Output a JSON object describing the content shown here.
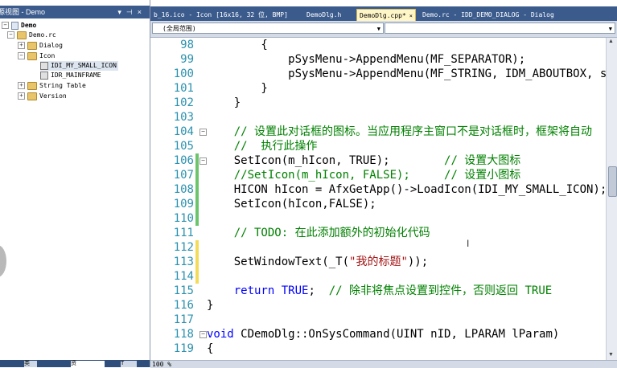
{
  "resource_view": {
    "title": "源视图 - Demo",
    "tree": [
      {
        "label": "Demo"
      },
      {
        "label": "Demo.rc"
      },
      {
        "label": "Dialog"
      },
      {
        "label": "Icon"
      },
      {
        "label": "IDI_MY_SMALL_ICON"
      },
      {
        "label": "IDR_MAINFRAME"
      },
      {
        "label": "String Table"
      },
      {
        "label": "Version"
      }
    ],
    "bottom_tabs": [
      {
        "label": "类"
      },
      {
        "label": "资"
      },
      {
        "label": "T"
      }
    ]
  },
  "tabs": [
    {
      "label": "b_16.ico - Icon [16x16, 32 位, BMP]"
    },
    {
      "label": "DemoDlg.h"
    },
    {
      "label": "DemoDlg.cpp*"
    },
    {
      "label": "Demo.rc - IDD_DEMO_DIALOG - Dialog"
    }
  ],
  "nav": {
    "scope_combo": "(全局范围)",
    "member_combo": ""
  },
  "status": {
    "zoom": "100 %"
  },
  "code": [
    {
      "num": "98",
      "text": "        {"
    },
    {
      "num": "99",
      "text": "            pSysMenu->AppendMenu(MF_SEPARATOR);"
    },
    {
      "num": "100",
      "text": "            pSysMenu->AppendMenu(MF_STRING, IDM_ABOUTBOX, strAb"
    },
    {
      "num": "101",
      "text": "        }"
    },
    {
      "num": "102",
      "text": "    }"
    },
    {
      "num": "103",
      "text": ""
    },
    {
      "num": "104",
      "text": "    // 设置此对话框的图标。当应用程序主窗口不是对话框时，框架将自动"
    },
    {
      "num": "105",
      "text": "    //  执行此操作"
    },
    {
      "num": "106",
      "text": "    SetIcon(m_hIcon, TRUE);        // 设置大图标"
    },
    {
      "num": "107",
      "text": "    //SetIcon(m_hIcon, FALSE);     // 设置小图标"
    },
    {
      "num": "108",
      "text": "    HICON hIcon = AfxGetApp()->LoadIcon(IDI_MY_SMALL_ICON);"
    },
    {
      "num": "109",
      "text": "    SetIcon(hIcon,FALSE);"
    },
    {
      "num": "110",
      "text": ""
    },
    {
      "num": "111",
      "text": "    // TODO: 在此添加额外的初始化代码"
    },
    {
      "num": "112",
      "text": ""
    },
    {
      "num": "113",
      "text": "    SetWindowText(_T(\"我的标题\"));"
    },
    {
      "num": "114",
      "text": ""
    },
    {
      "num": "115",
      "text": "    return TRUE;  // 除非将焦点设置到控件，否则返回 TRUE"
    },
    {
      "num": "116",
      "text": "}"
    },
    {
      "num": "117",
      "text": ""
    },
    {
      "num": "118",
      "text": "void CDemoDlg::OnSysCommand(UINT nID, LPARAM lParam)"
    },
    {
      "num": "119",
      "text": "{"
    }
  ],
  "colors": {
    "title_bar": "#3b5b8d",
    "line_number": "#2b91af",
    "keyword": "#0000ff",
    "comment": "#008000",
    "string": "#a31515",
    "change_saved": "#6cc56c",
    "change_unsaved": "#f3dc5a"
  }
}
